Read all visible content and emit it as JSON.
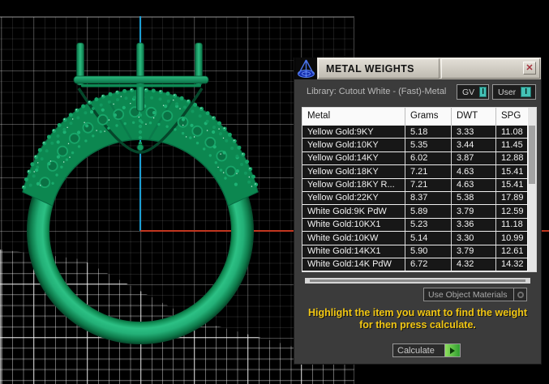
{
  "window": {
    "title": "METAL WEIGHTS",
    "close_glyph": "✕"
  },
  "viewport": {
    "axes": {
      "vertical_axis_color": "#1b9fd4",
      "horizontal_axis_color": "#c1361f"
    },
    "model_color": "#0e9a60",
    "grid_color_dim": "#2b2b2b",
    "grid_color_bright": "#8a8a8a"
  },
  "dialog": {
    "library_label": "Library: Cutout White - (Fast)-Metal",
    "gv_button": {
      "label": "GV",
      "indicator": "I"
    },
    "user_button": {
      "label": "User",
      "indicator": "I"
    },
    "table": {
      "columns": [
        "Metal",
        "Grams",
        "DWT",
        "SPG"
      ],
      "rows": [
        [
          "Yellow Gold:9KY",
          "5.18",
          "3.33",
          "11.08"
        ],
        [
          "Yellow Gold:10KY",
          "5.35",
          "3.44",
          "11.45"
        ],
        [
          "Yellow Gold:14KY",
          "6.02",
          "3.87",
          "12.88"
        ],
        [
          "Yellow Gold:18KY",
          "7.21",
          "4.63",
          "15.41"
        ],
        [
          "Yellow Gold:18KY R...",
          "7.21",
          "4.63",
          "15.41"
        ],
        [
          "Yellow Gold:22KY",
          "8.37",
          "5.38",
          "17.89"
        ],
        [
          "White Gold:9K PdW",
          "5.89",
          "3.79",
          "12.59"
        ],
        [
          "White Gold:10KX1",
          "5.23",
          "3.36",
          "11.18"
        ],
        [
          "White Gold:10KW",
          "5.14",
          "3.30",
          "10.99"
        ],
        [
          "White Gold:14KX1",
          "5.90",
          "3.79",
          "12.61"
        ],
        [
          "White Gold:14K PdW",
          "6.72",
          "4.32",
          "14.32"
        ]
      ]
    },
    "materials_select": {
      "value": "Use Object Materials"
    },
    "instruction_line1": "Highlight the item you want to find the weight",
    "instruction_line2": "for then press calculate.",
    "calculate_label": "Calculate",
    "accent_colors": {
      "indicator_teal": "#44c2b6",
      "instruction_yellow": "#f2c713",
      "calculate_green": "#2f9e30"
    }
  }
}
